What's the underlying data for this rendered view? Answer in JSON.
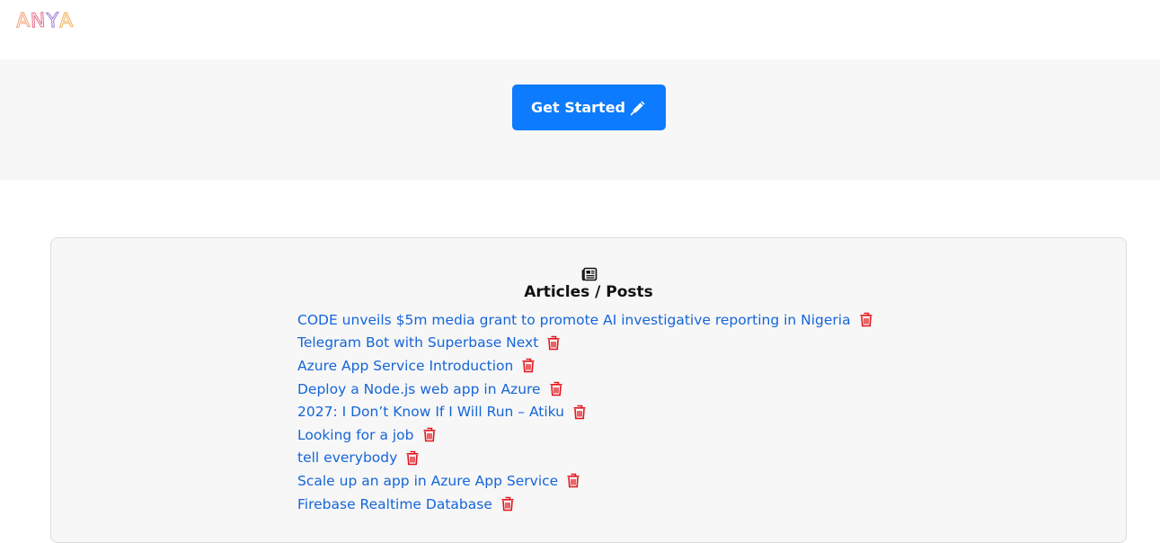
{
  "header": {
    "logo_letters": [
      "A",
      "N",
      "Y",
      "A"
    ],
    "logo_colors": [
      "#f4a37a",
      "#e46c8a",
      "#9b7ad6",
      "#f2b15a"
    ]
  },
  "hero": {
    "cta_label": "Get Started",
    "cta_icon": "pen-icon",
    "cta_color": "#0d7bfd"
  },
  "articles": {
    "icon": "newspaper-icon",
    "title": "Articles / Posts",
    "link_color": "#1565d8",
    "delete_icon": "trash-icon",
    "delete_color": "#e3141b",
    "items": [
      {
        "title": "CODE unveils $5m media grant to promote AI investigative reporting in Nigeria"
      },
      {
        "title": "Telegram Bot with Superbase Next"
      },
      {
        "title": "Azure App Service Introduction"
      },
      {
        "title": "Deploy a Node.js web app in Azure"
      },
      {
        "title": "2027: I Don’t Know If I Will Run – Atiku"
      },
      {
        "title": "Looking for a job"
      },
      {
        "title": "tell everybody"
      },
      {
        "title": "Scale up an app in Azure App Service"
      },
      {
        "title": "Firebase Realtime Database"
      }
    ]
  }
}
